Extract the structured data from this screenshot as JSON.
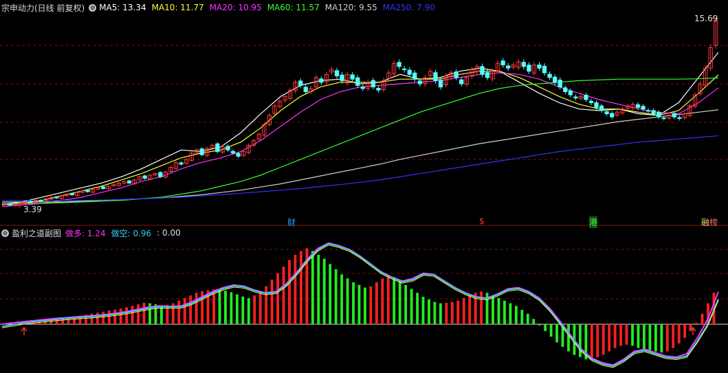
{
  "main_panel": {
    "title": "宗申动力(日线 前复权)",
    "legend": [
      {
        "label": "MA5: 13.34",
        "color": "#ffffff"
      },
      {
        "label": "MA10: 11.77",
        "color": "#ffff33"
      },
      {
        "label": "MA20: 10.95",
        "color": "#ff33ff"
      },
      {
        "label": "MA60: 11.57",
        "color": "#33ff33"
      },
      {
        "label": "MA120: 9.55",
        "color": "#d0d0d0"
      },
      {
        "label": "MA250: 7.90",
        "color": "#3333ff"
      }
    ],
    "high_label": "15.69",
    "low_label": "3.39",
    "event_markers": [
      {
        "label": "财",
        "color": "#3399ff"
      },
      {
        "label": "$",
        "color": "#ff3333"
      },
      {
        "label": "港",
        "color": "#33ff33"
      },
      {
        "label": "融",
        "color": "#ffcc66"
      },
      {
        "label": "榜",
        "color": "#ff6666"
      }
    ]
  },
  "sub_panel": {
    "title": "盈利之道副图",
    "legend": [
      {
        "label": "做多: 1.24",
        "color": "#ff33ff"
      },
      {
        "label": "做空: 0.96",
        "color": "#33ccff"
      },
      {
        "label": ": 0.00",
        "color": "#e0e0e0"
      }
    ]
  },
  "chart_data": [
    {
      "type": "candlestick",
      "title": "宗申动力(日线 前复权)",
      "y_axis_labels": [
        "15.69",
        "3.39"
      ],
      "series": [
        {
          "name": "MA5",
          "value": 13.34,
          "color": "#ffffff"
        },
        {
          "name": "MA10",
          "value": 11.77,
          "color": "#ffff33"
        },
        {
          "name": "MA20",
          "value": 10.95,
          "color": "#ff33ff"
        },
        {
          "name": "MA60",
          "value": 11.57,
          "color": "#33ff33"
        },
        {
          "name": "MA120",
          "value": 9.55,
          "color": "#d0d0d0"
        },
        {
          "name": "MA250",
          "value": 7.9,
          "color": "#3333ff"
        }
      ],
      "closes": [
        3.6,
        3.5,
        3.55,
        3.6,
        3.7,
        3.65,
        3.8,
        3.75,
        3.9,
        4.0,
        3.95,
        4.1,
        4.2,
        4.15,
        4.3,
        4.4,
        4.35,
        4.5,
        4.6,
        4.55,
        4.7,
        4.8,
        4.9,
        5.0,
        4.9,
        5.1,
        5.3,
        5.2,
        5.4,
        5.5,
        5.3,
        5.6,
        5.9,
        6.2,
        6.1,
        6.4,
        6.8,
        7.0,
        6.7,
        7.1,
        7.3,
        6.9,
        7.2,
        7.0,
        6.8,
        6.6,
        6.9,
        7.3,
        7.6,
        8.0,
        8.6,
        9.2,
        9.8,
        10.1,
        10.4,
        10.8,
        11.3,
        11.1,
        10.7,
        10.9,
        11.6,
        11.3,
        11.8,
        12.1,
        11.7,
        11.4,
        11.8,
        11.5,
        11.1,
        10.9,
        11.3,
        11.0,
        10.8,
        11.4,
        11.9,
        12.5,
        12.3,
        12.1,
        11.8,
        11.5,
        11.2,
        11.6,
        12.0,
        11.4,
        11.0,
        11.7,
        11.9,
        11.6,
        11.2,
        11.6,
        12.1,
        12.3,
        11.8,
        11.6,
        12.0,
        12.5,
        12.4,
        12.2,
        12.4,
        12.6,
        12.3,
        12.0,
        12.4,
        12.2,
        11.9,
        11.6,
        11.3,
        11.0,
        10.7,
        10.5,
        10.3,
        10.4,
        10.2,
        10.0,
        9.7,
        9.5,
        9.3,
        9.1,
        9.4,
        9.6,
        9.8,
        9.9,
        9.7,
        9.6,
        9.5,
        9.3,
        9.1,
        9.0,
        9.2,
        9.1,
        9.0,
        9.3,
        9.8,
        10.5,
        11.2,
        12.2,
        13.5,
        15.2
      ],
      "ma_curves": {
        "MA5": [
          3.55,
          3.7,
          4.0,
          4.3,
          4.6,
          4.9,
          5.3,
          5.8,
          6.4,
          7.0,
          6.9,
          7.2,
          8.1,
          9.3,
          10.4,
          11.1,
          11.4,
          11.5,
          11.2,
          11.3,
          11.8,
          11.5,
          11.6,
          12.0,
          12.2,
          12.0,
          11.3,
          10.6,
          10.0,
          9.6,
          9.5,
          9.6,
          9.3,
          9.2,
          10.0,
          11.6,
          13.2
        ],
        "MA10": [
          3.5,
          3.6,
          3.8,
          4.1,
          4.4,
          4.7,
          5.1,
          5.5,
          6.0,
          6.5,
          6.8,
          7.0,
          7.5,
          8.4,
          9.5,
          10.4,
          11.0,
          11.3,
          11.3,
          11.3,
          11.5,
          11.5,
          11.5,
          11.8,
          12.0,
          12.0,
          11.6,
          11.0,
          10.4,
          9.9,
          9.6,
          9.6,
          9.4,
          9.2,
          9.5,
          10.6,
          11.77
        ],
        "MA20": [
          3.4,
          3.5,
          3.6,
          3.8,
          4.0,
          4.3,
          4.6,
          5.0,
          5.3,
          5.8,
          6.2,
          6.5,
          6.9,
          7.6,
          8.5,
          9.4,
          10.2,
          10.7,
          11.0,
          11.1,
          11.2,
          11.3,
          11.4,
          11.6,
          11.8,
          11.9,
          11.8,
          11.5,
          11.0,
          10.6,
          10.2,
          9.9,
          9.6,
          9.4,
          9.3,
          10.0,
          10.95
        ],
        "MA60": [
          3.6,
          3.6,
          3.6,
          3.65,
          3.7,
          3.75,
          3.8,
          3.9,
          4.0,
          4.2,
          4.4,
          4.7,
          5.0,
          5.4,
          5.9,
          6.4,
          6.9,
          7.4,
          7.9,
          8.4,
          8.9,
          9.4,
          9.8,
          10.2,
          10.6,
          10.9,
          11.1,
          11.2,
          11.3,
          11.4,
          11.45,
          11.5,
          11.5,
          11.5,
          11.5,
          11.52,
          11.57
        ],
        "MA120": [
          3.7,
          3.7,
          3.7,
          3.7,
          3.75,
          3.8,
          3.85,
          3.9,
          3.95,
          4.05,
          4.15,
          4.3,
          4.45,
          4.65,
          4.85,
          5.1,
          5.35,
          5.6,
          5.85,
          6.1,
          6.4,
          6.65,
          6.9,
          7.15,
          7.4,
          7.6,
          7.8,
          8.0,
          8.2,
          8.4,
          8.6,
          8.8,
          8.95,
          9.1,
          9.25,
          9.4,
          9.55
        ],
        "MA250": [
          3.8,
          3.8,
          3.8,
          3.8,
          3.8,
          3.82,
          3.85,
          3.9,
          3.95,
          4.0,
          4.08,
          4.16,
          4.25,
          4.35,
          4.45,
          4.55,
          4.68,
          4.8,
          4.95,
          5.1,
          5.3,
          5.5,
          5.7,
          5.9,
          6.1,
          6.3,
          6.5,
          6.7,
          6.9,
          7.05,
          7.2,
          7.35,
          7.5,
          7.6,
          7.7,
          7.8,
          7.9
        ]
      }
    },
    {
      "type": "bar",
      "title": "盈利之道副图",
      "series": [
        {
          "name": "做多",
          "value": 1.24,
          "color": "#ff33ff"
        },
        {
          "name": "做空",
          "value": 0.96,
          "color": "#33ccff"
        }
      ],
      "zero_line": 0.0,
      "histogram": [
        0.05,
        0.08,
        0.12,
        0.15,
        0.18,
        0.2,
        0.22,
        0.25,
        0.27,
        0.3,
        0.33,
        0.36,
        0.4,
        0.44,
        0.48,
        0.52,
        0.56,
        0.6,
        0.65,
        0.7,
        0.76,
        0.82,
        0.8,
        0.76,
        0.72,
        0.74,
        0.8,
        0.9,
        1.0,
        1.1,
        1.2,
        1.26,
        1.3,
        1.33,
        1.32,
        1.28,
        1.22,
        1.14,
        1.06,
        1.0,
        1.1,
        1.25,
        1.45,
        1.7,
        1.95,
        2.2,
        2.45,
        2.65,
        2.8,
        2.9,
        2.8,
        2.65,
        2.5,
        2.3,
        2.1,
        1.9,
        1.75,
        1.6,
        1.5,
        1.4,
        1.45,
        1.6,
        1.75,
        1.85,
        1.8,
        1.65,
        1.5,
        1.35,
        1.2,
        1.05,
        0.95,
        0.85,
        0.8,
        0.82,
        0.85,
        0.9,
        1.0,
        1.1,
        1.2,
        1.25,
        1.2,
        1.1,
        1.0,
        0.9,
        0.8,
        0.7,
        0.55,
        0.4,
        0.2,
        -0.05,
        -0.3,
        -0.55,
        -0.8,
        -1.0,
        -1.2,
        -1.35,
        -1.45,
        -1.55,
        -1.5,
        -1.45,
        -1.35,
        -1.2,
        -1.05,
        -0.95,
        -0.9,
        -0.95,
        -1.05,
        -1.1,
        -1.15,
        -1.2,
        -1.25,
        -1.2,
        -1.05,
        -0.85,
        -0.6,
        -0.3,
        0.05,
        0.4,
        0.8,
        1.2
      ],
      "long_line": [
        0.0,
        0.05,
        0.1,
        0.14,
        0.18,
        0.22,
        0.25,
        0.28,
        0.31,
        0.34,
        0.38,
        0.43,
        0.5,
        0.58,
        0.66,
        0.7,
        0.68,
        0.7,
        0.85,
        1.05,
        1.25,
        1.4,
        1.5,
        1.45,
        1.3,
        1.2,
        1.25,
        1.55,
        2.0,
        2.5,
        2.9,
        3.1,
        3.0,
        2.85,
        2.6,
        2.3,
        2.0,
        1.8,
        1.65,
        1.75,
        1.95,
        1.9,
        1.65,
        1.4,
        1.2,
        1.05,
        1.0,
        1.15,
        1.35,
        1.4,
        1.25,
        1.0,
        0.6,
        0.1,
        -0.5,
        -1.1,
        -1.5,
        -1.7,
        -1.8,
        -1.55,
        -1.2,
        -1.1,
        -1.25,
        -1.4,
        -1.45,
        -1.3,
        -0.6,
        0.2,
        1.24
      ],
      "short_line": [
        -0.1,
        -0.02,
        0.05,
        0.1,
        0.14,
        0.18,
        0.22,
        0.25,
        0.28,
        0.31,
        0.35,
        0.4,
        0.46,
        0.54,
        0.62,
        0.67,
        0.66,
        0.67,
        0.8,
        1.0,
        1.2,
        1.36,
        1.47,
        1.43,
        1.28,
        1.18,
        1.22,
        1.5,
        1.95,
        2.45,
        2.85,
        3.08,
        2.98,
        2.83,
        2.58,
        2.28,
        1.98,
        1.78,
        1.62,
        1.7,
        1.92,
        1.88,
        1.63,
        1.38,
        1.18,
        1.03,
        0.98,
        1.12,
        1.32,
        1.37,
        1.22,
        0.96,
        0.55,
        0.04,
        -0.56,
        -1.15,
        -1.55,
        -1.75,
        -1.85,
        -1.6,
        -1.25,
        -1.15,
        -1.3,
        -1.45,
        -1.5,
        -1.4,
        -0.75,
        0.0,
        0.96
      ]
    }
  ]
}
